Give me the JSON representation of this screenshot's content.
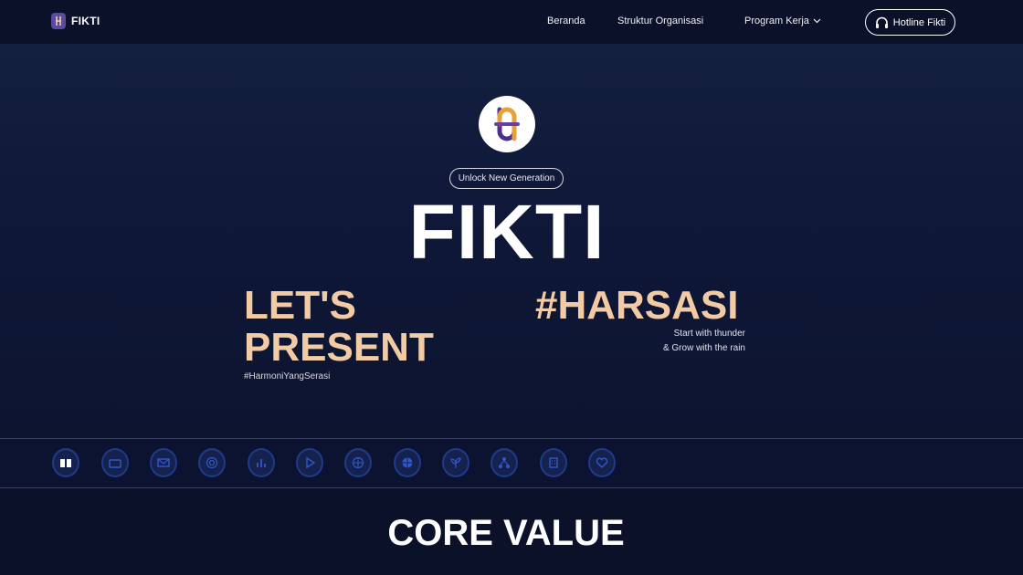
{
  "navbar": {
    "brand": "FIKTI",
    "links": [
      "Beranda",
      "Struktur Organisasi",
      "Program Kerja"
    ],
    "hotline": "Hotline Fikti"
  },
  "hero": {
    "tagline": "Unlock New Generation",
    "title": "FIKTI",
    "lets_line1": "LET'S",
    "lets_line2": "PRESENT",
    "lets_sub": "#HarmoniYangSerasi",
    "harsasi": "#HARSASI",
    "harsasi_sub1": "Start with thunder",
    "harsasi_sub2": "& Grow with the rain"
  },
  "icons": [
    "book-icon",
    "briefcase-icon",
    "mail-icon",
    "target-icon",
    "chart-icon",
    "play-icon",
    "globe-icon",
    "basketball-icon",
    "plant-icon",
    "network-icon",
    "building-icon",
    "heart-icon"
  ],
  "core": {
    "title": "CORE VALUE"
  },
  "colors": {
    "accent": "#f2cba4",
    "background": "#0c1330",
    "navbar": "#0b1129"
  }
}
